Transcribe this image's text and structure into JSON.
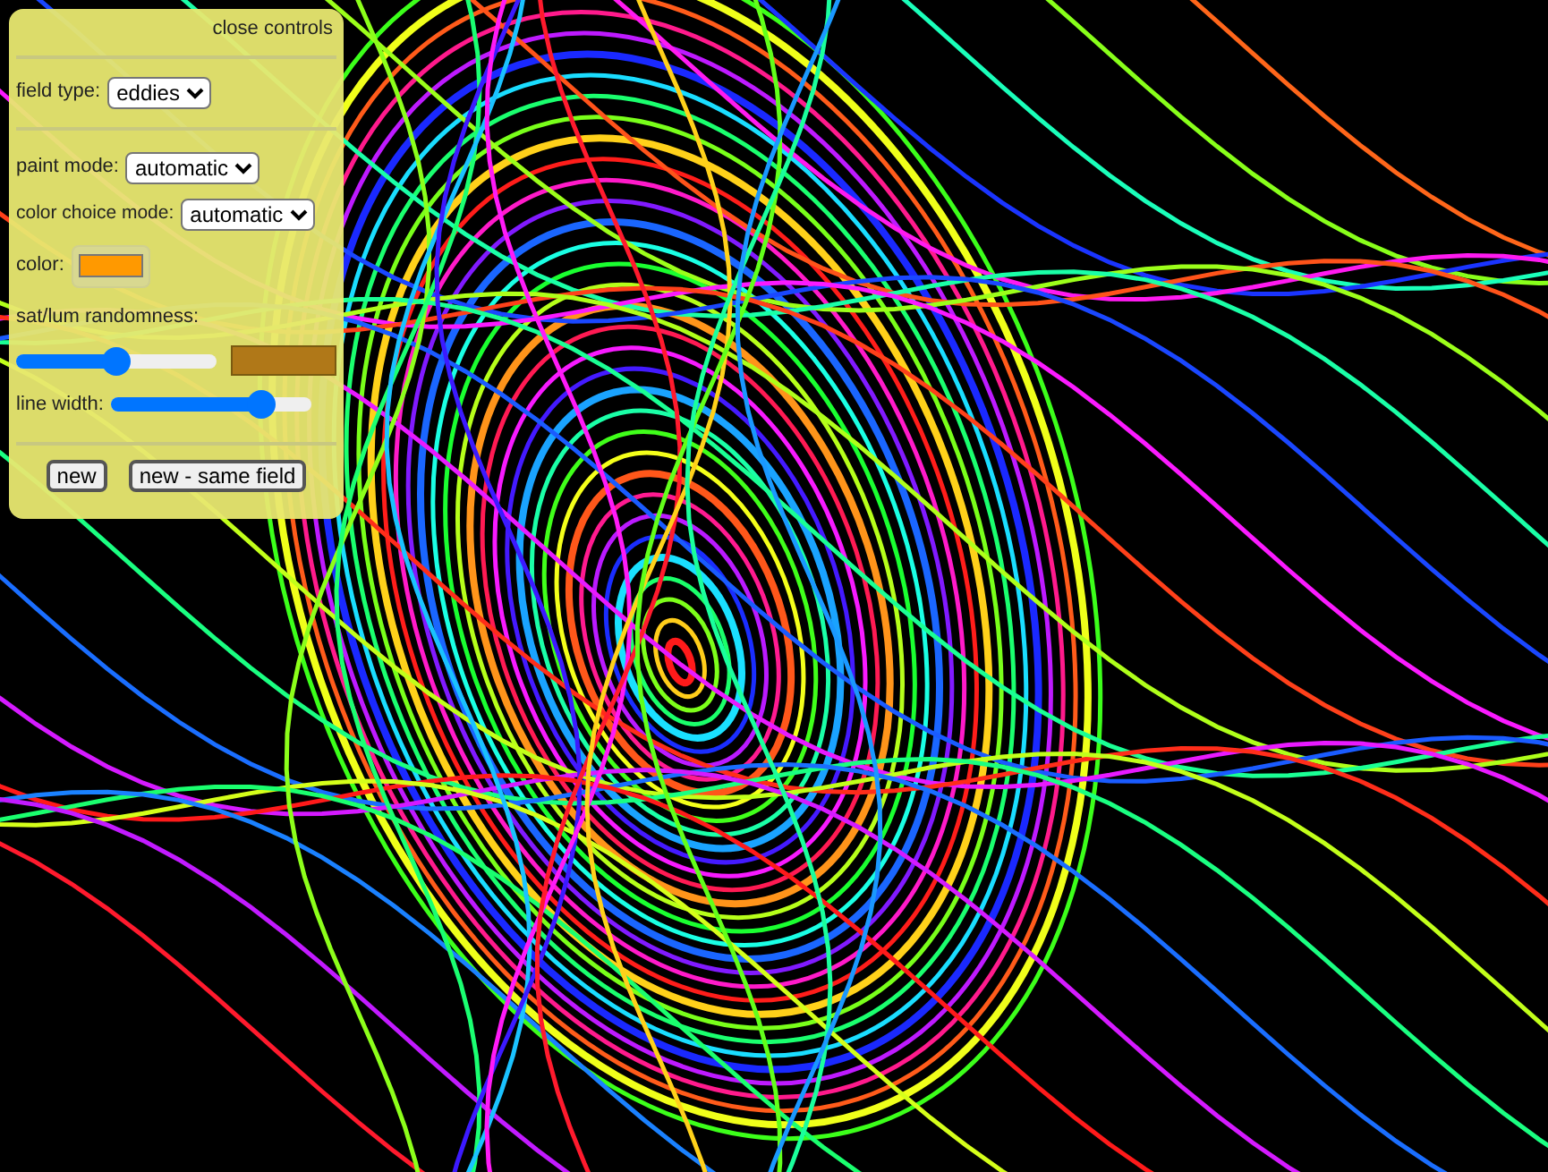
{
  "controls": {
    "close_label": "close controls",
    "field_type": {
      "label": "field type:",
      "value": "eddies"
    },
    "paint_mode": {
      "label": "paint mode:",
      "value": "automatic"
    },
    "color_choice_mode": {
      "label": "color choice mode:",
      "value": "automatic"
    },
    "color_picker": {
      "label": "color:",
      "color": "#ff9900"
    },
    "randomness": {
      "label": "sat/lum randomness:",
      "level": 0.5,
      "color": "#b07818"
    },
    "line_width": {
      "label": "line width:",
      "level": 0.75
    },
    "buttons": [
      "new",
      "new - same field"
    ]
  }
}
